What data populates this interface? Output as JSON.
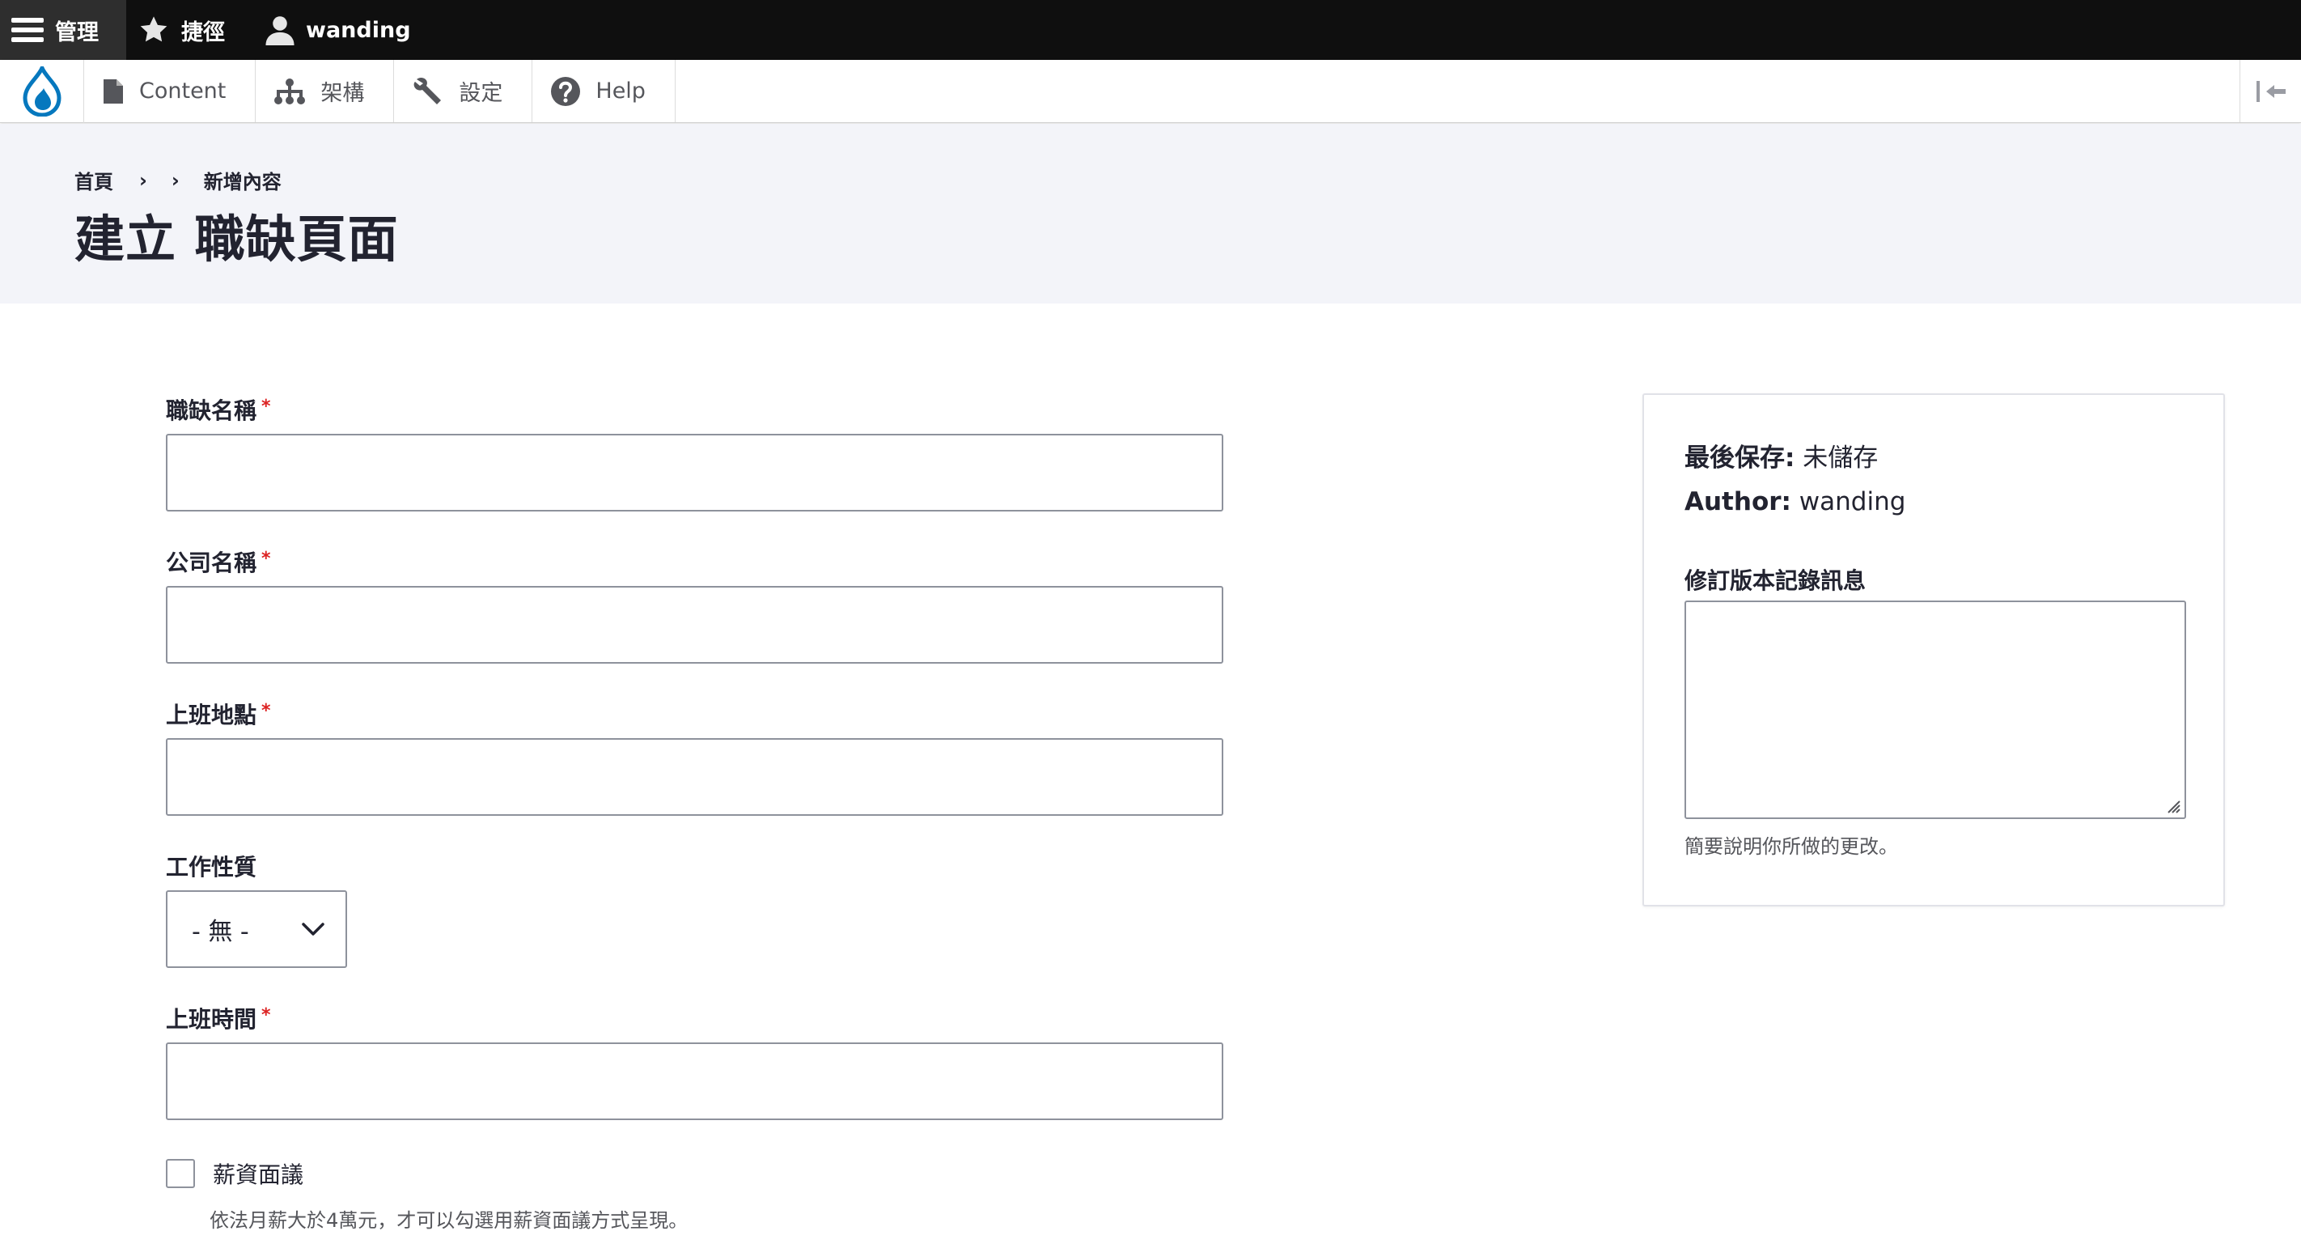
{
  "admin_bar": {
    "manage_label": "管理",
    "shortcuts_label": "捷徑",
    "user_label": "wanding",
    "icons": [
      "menu-icon",
      "star-icon",
      "user-icon"
    ]
  },
  "tray": {
    "items": [
      {
        "label": "Content",
        "icon": "document-icon"
      },
      {
        "label": "架構",
        "icon": "sitemap-icon"
      },
      {
        "label": "設定",
        "icon": "wrench-icon"
      },
      {
        "label": "Help",
        "icon": "help-icon"
      }
    ],
    "logo_icon": "drupal-drop-icon",
    "collapse_icon": "collapse-tray-icon"
  },
  "breadcrumb": {
    "home": "首頁",
    "separator": "›",
    "current": "新增內容"
  },
  "page_title": "建立 職缺頁面",
  "form": {
    "job_title": {
      "label": "職缺名稱",
      "required_mark": "*",
      "value": ""
    },
    "company": {
      "label": "公司名稱",
      "required_mark": "*",
      "value": ""
    },
    "location": {
      "label": "上班地點",
      "required_mark": "*",
      "value": ""
    },
    "job_type": {
      "label": "工作性質",
      "selected": "- 無 -"
    },
    "work_hours": {
      "label": "上班時間",
      "required_mark": "*",
      "value": ""
    },
    "salary_negotiable": {
      "label": "薪資面議",
      "checked": false,
      "description": "依法月薪大於4萬元，才可以勾選用薪資面議方式呈現。"
    }
  },
  "meta": {
    "last_saved_label": "最後保存:",
    "last_saved_value": "未儲存",
    "author_label": "Author:",
    "author_value": "wanding",
    "revision_label": "修訂版本記錄訊息",
    "revision_value": "",
    "revision_description": "簡要說明你所做的更改。"
  },
  "colors": {
    "admin_bar_bg": "#0f0f0f",
    "required": "#dc2323",
    "header_band": "#f3f4f9",
    "drupal_blue": "#0678be"
  }
}
